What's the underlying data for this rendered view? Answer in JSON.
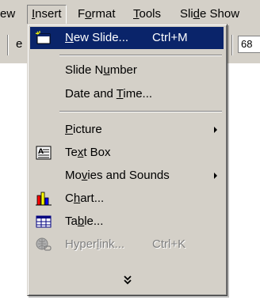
{
  "menubar": {
    "items": [
      {
        "label": "ew"
      },
      {
        "label": "Insert",
        "open": true
      },
      {
        "label": "Format"
      },
      {
        "label": "Tools"
      },
      {
        "label": "Slide Show"
      }
    ]
  },
  "toolbar": {
    "partial_text": "e",
    "zoom_value": "68"
  },
  "insert_menu": {
    "items": [
      {
        "label": "New Slide...",
        "shortcut": "Ctrl+M",
        "icon": "new-slide-icon",
        "selected": true
      },
      {
        "label": "Slide Number"
      },
      {
        "label": "Date and Time..."
      },
      {
        "label": "Picture",
        "submenu": true
      },
      {
        "label": "Text Box",
        "icon": "text-box-icon"
      },
      {
        "label": "Movies and Sounds",
        "submenu": true
      },
      {
        "label": "Chart...",
        "icon": "chart-icon"
      },
      {
        "label": "Table...",
        "icon": "table-icon"
      },
      {
        "label": "Hyperlink...",
        "shortcut": "Ctrl+K",
        "icon": "hyperlink-icon",
        "disabled": true
      }
    ],
    "expand_icon": "double-chevron-down-icon"
  },
  "colors": {
    "menu_face": "#d4d0c8",
    "selection": "#0a246a",
    "disabled_text": "#808080"
  }
}
